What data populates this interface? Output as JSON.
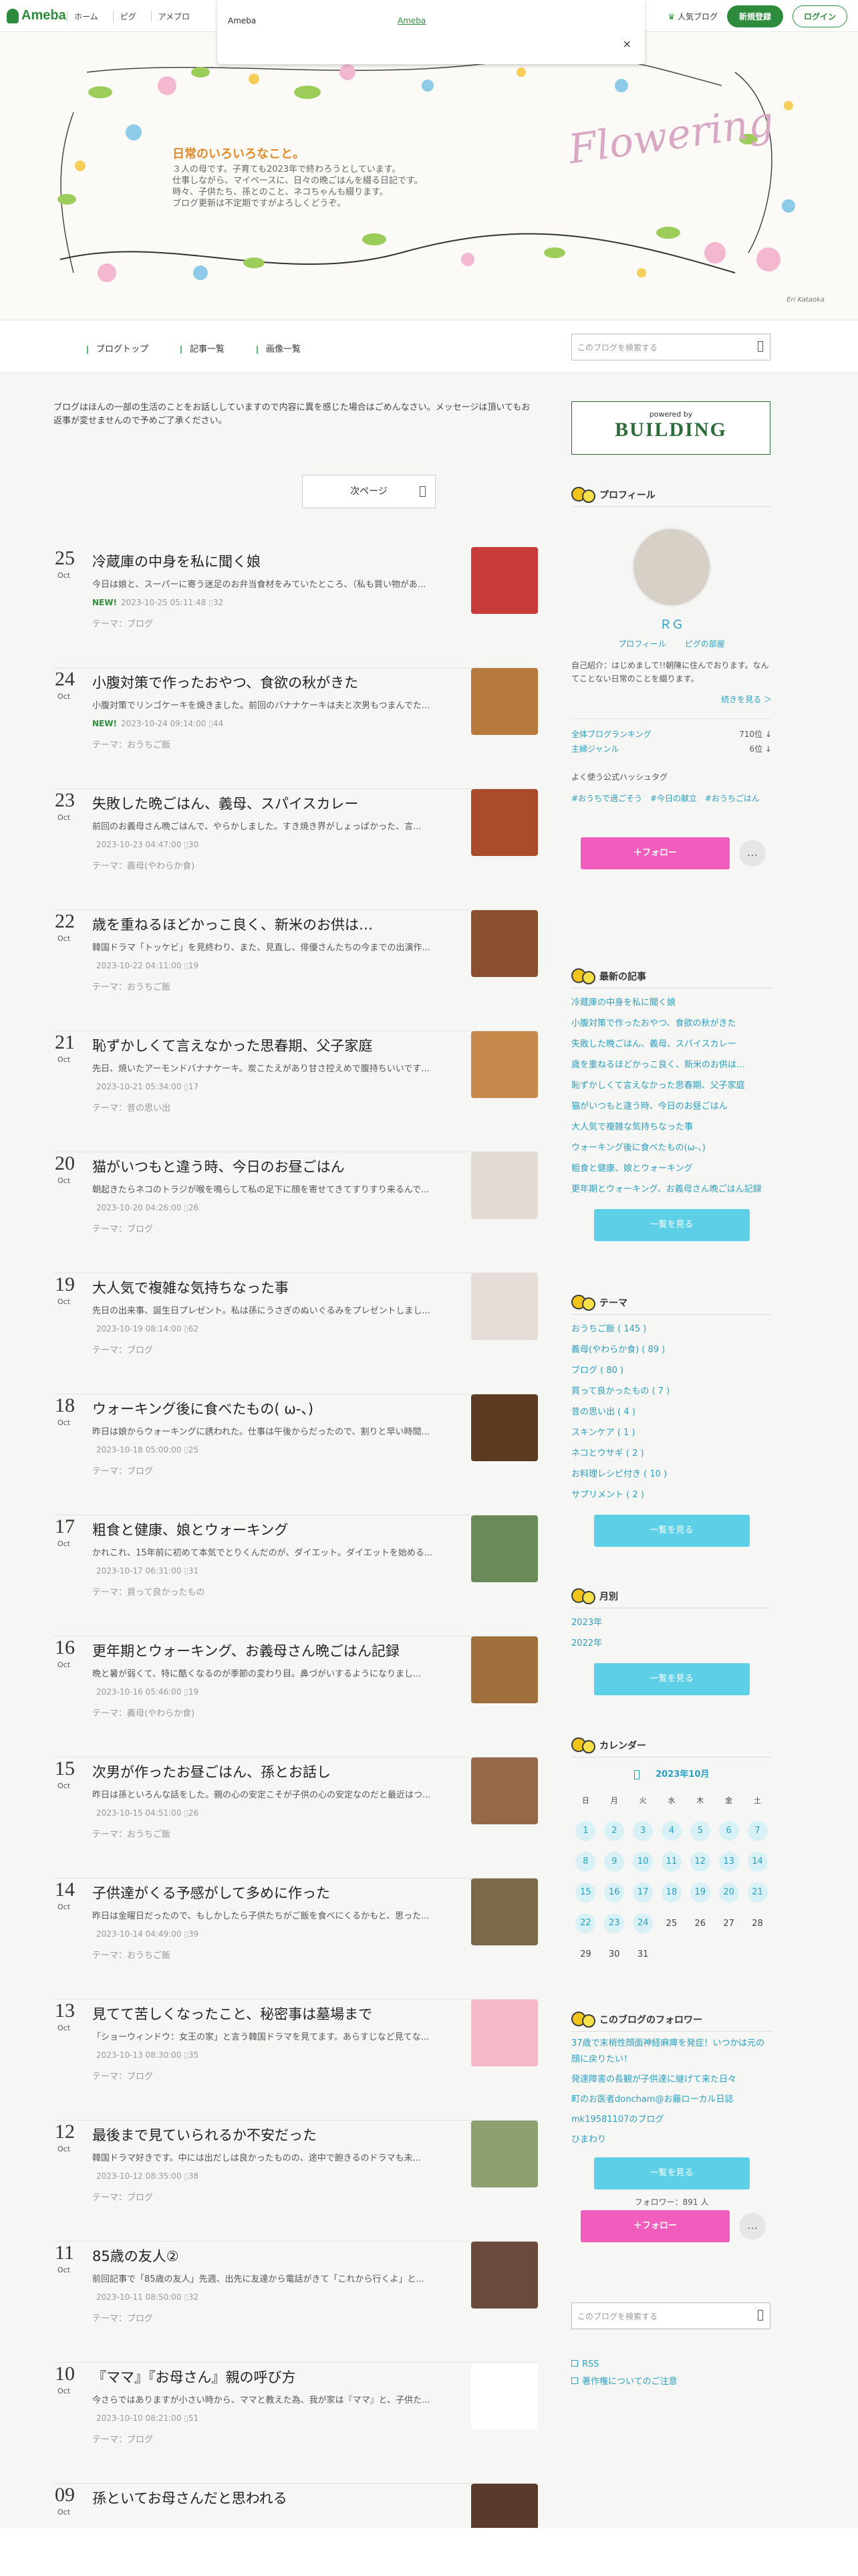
{
  "topbar": {
    "logo": "Ameba",
    "nav": [
      "ホーム",
      "ピグ",
      "アメブロ"
    ],
    "popup": {
      "left_label": "Ameba",
      "link": "Ameba",
      "close": "×"
    },
    "ranking": "人気ブログ",
    "signup": "新規登録",
    "login": "ログイン"
  },
  "header": {
    "title": "日常のいろいろなこと。",
    "desc_lines": [
      "３人の母です。子育ても2023年で終わろうとしています。",
      "仕事しながら、マイペースに、日々の晩ごはんを綴る日記です。",
      "時々、子供たち、孫とのこと、ネコちゃんも綴ります。",
      "ブログ更新は不定期ですがよろしくどうぞ。"
    ],
    "art_text": "Flowering",
    "signature": "Eri Kataoka"
  },
  "blognav": {
    "items": [
      "ブログトップ",
      "記事一覧",
      "画像一覧"
    ],
    "search_placeholder": "このブログを検索する"
  },
  "main": {
    "notice": "ブログはほんの一部の生活のことをお話ししていますので内容に異を感じた場合はごめんなさい。メッセージは頂いてもお返事が変せませんので予めご了承ください。",
    "next_page": "次ページ",
    "entries": [
      {
        "day": "25",
        "mon": "Oct",
        "title": "冷蔵庫の中身を私に聞く娘",
        "excerpt": "今日は娘と、スーパーに寄う迷足のお弁当食材をみていたところ、（私も買い物があ...",
        "new": "NEW!",
        "meta": "2023-10-25 05:11:48",
        "count": "32",
        "theme": "テーマ：ブログ",
        "color": "#c83b3b"
      },
      {
        "day": "24",
        "mon": "Oct",
        "title": "小腹対策で作ったおやつ、食欲の秋がきた",
        "excerpt": "小腹対策でリンゴケーキを焼きました。前回のバナナケーキは夫と次男もつまんでた...",
        "new": "NEW!",
        "meta": "2023-10-24 09:14:00",
        "count": "44",
        "theme": "テーマ：おうちご飯",
        "color": "#b67a3c"
      },
      {
        "day": "23",
        "mon": "Oct",
        "title": "失敗した晩ごはん、義母、スパイスカレー",
        "excerpt": "前回のお義母さん晩ごはんで、やらかしました。すき焼き界がしょっぱかった、言...",
        "new": "",
        "meta": "2023-10-23 04:47:00",
        "count": "30",
        "theme": "テーマ：義母(やわらか食)",
        "color": "#a84c2c"
      },
      {
        "day": "22",
        "mon": "Oct",
        "title": "歳を重ねるほどかっこ良く、新米のお供は…",
        "excerpt": "韓国ドラマ「トッケビ」を見終わり、また、見直し、俳優さんたちの今までの出演作...",
        "new": "",
        "meta": "2023-10-22 04:11:00",
        "count": "19",
        "theme": "テーマ：おうちご飯",
        "color": "#8a5030"
      },
      {
        "day": "21",
        "mon": "Oct",
        "title": "恥ずかしくて言えなかった思春期、父子家庭",
        "excerpt": "先日、焼いたアーモンドバナナケーキ。炭こたえがあり甘さ控えめで腹持ちいいです...",
        "new": "",
        "meta": "2023-10-21 05:34:00",
        "count": "17",
        "theme": "テーマ：昔の思い出",
        "color": "#c88a4c"
      },
      {
        "day": "20",
        "mon": "Oct",
        "title": "猫がいつもと違う時、今日のお昼ごはん",
        "excerpt": "朝起きたらネコのトラジが喉を鳴らして私の足下に顔を寄せてきてすりすり来るんで...",
        "new": "",
        "meta": "2023-10-20 04:26:00",
        "count": "26",
        "theme": "テーマ：ブログ",
        "color": "#e2dcd4"
      },
      {
        "day": "19",
        "mon": "Oct",
        "title": "大人気で複雑な気持ちなった事",
        "excerpt": "先日の出来事、誕生日プレゼント。私は孫にうさぎのぬいぐるみをプレゼントしまし...",
        "new": "",
        "meta": "2023-10-19 08:14:00",
        "count": "62",
        "theme": "テーマ：ブログ",
        "color": "#e7ddd8"
      },
      {
        "day": "18",
        "mon": "Oct",
        "title": "ウォーキング後に食べたもの( ω-、)",
        "excerpt": "昨日は娘からウォーキングに誘われた。仕事は午後からだったので、割りと早い時間...",
        "new": "",
        "meta": "2023-10-18 05:00:00",
        "count": "25",
        "theme": "テーマ：ブログ",
        "color": "#5c3b22"
      },
      {
        "day": "17",
        "mon": "Oct",
        "title": "粗食と健康、娘とウォーキング",
        "excerpt": "かれこれ、15年前に初めて本気でとりくんだのが、ダイエット。ダイエットを始める...",
        "new": "",
        "meta": "2023-10-17 06:31:00",
        "count": "31",
        "theme": "テーマ：買って良かったもの",
        "color": "#6a8a5a"
      },
      {
        "day": "16",
        "mon": "Oct",
        "title": "更年期とウォーキング、お義母さん晩ごはん記録",
        "excerpt": "晩と暑が弱くて、特に酷くなるのが季節の変わり目。鼻づがいするようになりまし...",
        "new": "",
        "meta": "2023-10-16 05:46:00",
        "count": "19",
        "theme": "テーマ：義母(やわらか食)",
        "color": "#a0703c"
      },
      {
        "day": "15",
        "mon": "Oct",
        "title": "次男が作ったお昼ごはん、孫とお話し",
        "excerpt": "昨日は孫といろんな話をした。親の心の安定こそが子供の心の安定なのだと最近はつ...",
        "new": "",
        "meta": "2023-10-15 04:51:00",
        "count": "26",
        "theme": "テーマ：おうちご飯",
        "color": "#946848"
      },
      {
        "day": "14",
        "mon": "Oct",
        "title": "子供達がくる予感がして多めに作った",
        "excerpt": "昨日は金曜日だったので、もしかしたら子供たちがご飯を食べにくるかもと、思った...",
        "new": "",
        "meta": "2023-10-14 04:49:00",
        "count": "39",
        "theme": "テーマ：おうちご飯",
        "color": "#7a6a4a"
      },
      {
        "day": "13",
        "mon": "Oct",
        "title": "見てて苦しくなったこと、秘密事は墓場まで",
        "excerpt": "「ショーウィンドウ：女王の家」と言う韓国ドラマを見てます。あらすじなど見てな...",
        "new": "",
        "meta": "2023-10-13 08:30:00",
        "count": "35",
        "theme": "テーマ：ブログ",
        "color": "#f4b8c8"
      },
      {
        "day": "12",
        "mon": "Oct",
        "title": "最後まで見ていられるか不安だった",
        "excerpt": "韓国ドラマ好きです。中には出だしは良かったものの、途中で飽きるのドラマも未...",
        "new": "",
        "meta": "2023-10-12 08:35:00",
        "count": "38",
        "theme": "テーマ：ブログ",
        "color": "#8ea070"
      },
      {
        "day": "11",
        "mon": "Oct",
        "title": "85歳の友人②",
        "excerpt": "前回記事で「85歳の友人」先週、出先に友達から電話がきて「これから行くよ」と...",
        "new": "",
        "meta": "2023-10-11 08:50:00",
        "count": "32",
        "theme": "テーマ：ブログ",
        "color": "#6a4a3a"
      },
      {
        "day": "10",
        "mon": "Oct",
        "title": "『ママ』『お母さん』親の呼び方",
        "excerpt": "今さらではありますが小さい時から、ママと教えた為、我が家は『ママ』と、子供た...",
        "new": "",
        "meta": "2023-10-10 08:21:00",
        "count": "51",
        "theme": "テーマ：ブログ",
        "color": "#ffffff"
      },
      {
        "day": "09",
        "mon": "Oct",
        "title": "孫といてお母さんだと思われる",
        "excerpt": "",
        "new": "",
        "meta": "",
        "count": "",
        "theme": "",
        "color": "#5a3a2a"
      }
    ]
  },
  "sidebar": {
    "building": {
      "powered": "powered by",
      "name": "BUILDING"
    },
    "profile": {
      "heading": "プロフィール",
      "name": "ＲＧ",
      "links": [
        "プロフィール",
        "ピグの部屋"
      ],
      "intro": "自己紹介：はじめまして!!朝陳に住んでおります。なんてことない日常のことを綴ります。",
      "more": "続きを見る ＞",
      "ranking_label": "全体ブログランキング",
      "ranking_value": "710位 ↓",
      "genre_label": "主婦ジャンル",
      "genre_value": "6位 ↓",
      "hashtag_heading": "よく使う公式ハッシュタグ",
      "hashtags": [
        "#おうちで過ごそう",
        "#今日の献立",
        "#おうちごはん"
      ],
      "follow": "＋フォロー",
      "dots": "…"
    },
    "recent": {
      "heading": "最新の記事",
      "items": [
        "冷蔵庫の中身を私に聞く娘",
        "小腹対策で作ったおやつ、食欲の秋がきた",
        "失敗した晩ごはん、義母、スパイスカレー",
        "歳を重ねるほどかっこ良く、新米のお供は…",
        "恥ずかしくて言えなかった思春期、父子家庭",
        "猫がいつもと違う時、今日のお昼ごはん",
        "大人気で複雑な気持ちなった事",
        "ウォーキング後に食べたもの(ω-、)",
        "粗食と健康、娘とウォーキング",
        "更年期とウォーキング、お義母さん晩ごはん記録"
      ],
      "button": "一覧を見る"
    },
    "theme": {
      "heading": "テーマ",
      "items": [
        "おうちご飯 ( 145 )",
        "義母(やわらか食) ( 89 )",
        "ブログ ( 80 )",
        "買って良かったもの ( 7 )",
        "昔の思い出 ( 4 )",
        "スキンケア ( 1 )",
        "ネコとウサギ ( 2 )",
        "お料理レシピ付き ( 10 )",
        "サプリメント ( 2 )"
      ],
      "button": "一覧を見る"
    },
    "monthly": {
      "heading": "月別",
      "items": [
        "2023年",
        "2022年"
      ],
      "button": "一覧を見る"
    },
    "calendar": {
      "heading": "カレンダー",
      "month": "2023年10月",
      "weekdays": [
        "日",
        "月",
        "火",
        "水",
        "木",
        "金",
        "土"
      ],
      "weeks": [
        [
          "1",
          "2",
          "3",
          "4",
          "5",
          "6",
          "7"
        ],
        [
          "8",
          "9",
          "10",
          "11",
          "12",
          "13",
          "14"
        ],
        [
          "15",
          "16",
          "17",
          "18",
          "19",
          "20",
          "21"
        ],
        [
          "22",
          "23",
          "24",
          "25",
          "26",
          "27",
          "28"
        ],
        [
          "29",
          "30",
          "31",
          "",
          "",
          "",
          ""
        ]
      ],
      "linked_through": 24
    },
    "followers": {
      "heading": "このブログのフォロワー",
      "items": [
        "37歳で末梢性顔面神経麻痺を発症！いつかは元の顔に戻りたい！",
        "発達障害の長観が子供達に継げて来た日々",
        "町のお医者doncham@お藤ローカル日誌",
        "mk19581107のブログ",
        "ひまわり"
      ],
      "button": "一覧を見る",
      "count": "フォロワー：891 人",
      "follow": "＋フォロー",
      "dots": "…"
    },
    "search_placeholder": "このブログを検索する",
    "rss": "RSS",
    "copyright": "著作権についてのご注意"
  },
  "colors": {
    "accent_green": "#2d8c3c",
    "link_blue": "#2a9fbf",
    "button_blue": "#5dd0e8",
    "follow_pink": "#f05dbc"
  }
}
